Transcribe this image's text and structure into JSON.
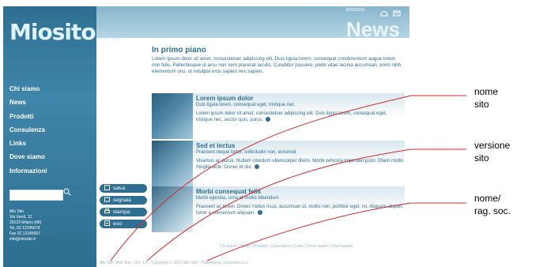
{
  "logo": "Miosito.it",
  "header": {
    "date": "20/02/2001",
    "watermark": "News"
  },
  "nav": {
    "items": [
      "Chi siamo",
      "News",
      "Prodotti",
      "Consulenza",
      "Links",
      "Dove siamo",
      "Informazioni"
    ]
  },
  "search": {
    "placeholder": ""
  },
  "address": "Mio Sito\nVia Verdi, 12\n20123 Milano (MI)\nTel. 02 12345678\nFax 02 12345657\ninfo@miosito.it",
  "main": {
    "section_title": "In primo piano",
    "intro": "Lorem ipsum dolor sit amet, consectetuer adipiscing elit. Duis ligula lorem, consequat condimentum augue lorem non felis. Pellentesque id arcu non sem placerat iaculis. Curabitur posuere, pede vitae lacinia accumsan, enim nibh elementum orci, ut volutpat eros sapien nec sapien.",
    "articles": [
      {
        "title": "Lorem ipsum dolor",
        "subtitle": "Duis ligula lorem, consequat eget, tristique nec",
        "body": "Lorem ipsum dolor sit amet, consectetuer adipiscing elit. Duis ligula lorem, consequat eget, tristique nec, auctor quis, purus."
      },
      {
        "title": "Sed et lectus",
        "subtitle": "Praesent neque tortor, sollicitudin non, euismod",
        "body": "Vivamus ac purus. Nullam interdum ullamcorper libero. Morbi vehicula imperdiet justo. Etiam mollis fringilla ante. Donec et dui."
      },
      {
        "title": "Morbi consequat felis",
        "subtitle": "Morbi egestas, urna et mollis bibendum",
        "body": "Praesent ac lorem. Donec metus risus, accumsan ut, mollis non, porttitor eget, mi. Aliquam aliquet, tortor a elementum aliquam."
      }
    ]
  },
  "actions": {
    "save": "salva",
    "report": "segnala",
    "print": "stampa",
    "exit": "esci"
  },
  "footer": {
    "links": "Chi siamo  |  News  |  Prodotti  |  Consulenza  |  Links  |  Dove siamo  |  Informazioni",
    "copyright": "Mio Sito Web Site - Ver. 1.0 - Copyright © 2001 Mio Sito - Powered by Soluzione s.r.l."
  },
  "callouts": {
    "site_name": "nome\nsito",
    "site_version": "versione\nsito",
    "company_name": "nome/\nrag. soc."
  },
  "colors": {
    "accent": "#2f6f92",
    "callout_line": "#d22a2a"
  }
}
